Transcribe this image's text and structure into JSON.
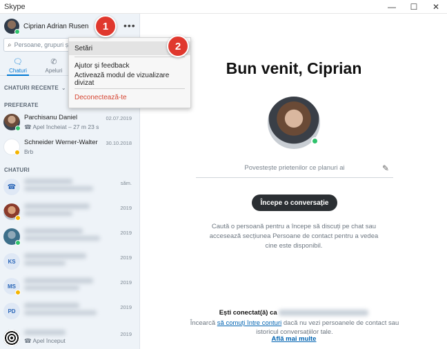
{
  "window": {
    "title": "Skype",
    "minimize": "—",
    "maximize": "☐",
    "close": "✕"
  },
  "profile": {
    "name": "Ciprian Adrian Rusen",
    "more": "•••"
  },
  "search": {
    "placeholder": "Persoane, grupuri și mesaje",
    "icon": "search-icon"
  },
  "nav": {
    "chats": "Chaturi",
    "calls": "Apeluri"
  },
  "sections": {
    "recent": "CHATURI RECENTE",
    "favorites": "PREFERATE",
    "chats": "CHATURI"
  },
  "menu": {
    "settings": "Setări",
    "help": "Ajutor și feedback",
    "split_view": "Activează modul de vizualizare divizat",
    "sign_out": "Deconectează-te"
  },
  "badges": {
    "one": "1",
    "two": "2"
  },
  "favorites": [
    {
      "name": "Parchisanu Daniel",
      "sub": "Apel încheiat – 27 m 23 s",
      "date": "02.07.2019",
      "presence": "online"
    },
    {
      "name": "Schneider Werner-Walter",
      "sub": "Brb",
      "date": "30.10.2018",
      "presence": "away"
    }
  ],
  "chats": [
    {
      "date": "săm.",
      "initials": "",
      "presence": ""
    },
    {
      "date": "2019",
      "initials": "",
      "presence": "away"
    },
    {
      "date": "2019",
      "initials": "",
      "presence": "online"
    },
    {
      "date": "2019",
      "initials": "KS",
      "presence": ""
    },
    {
      "date": "2019",
      "initials": "MS",
      "presence": "away"
    },
    {
      "date": "2019",
      "initials": "PD",
      "presence": ""
    },
    {
      "date": "2019",
      "initials": "",
      "presence": "",
      "sub": "Apel început"
    }
  ],
  "main": {
    "welcome": "Bun venit, Ciprian",
    "mood_placeholder": "Povestește prietenilor ce planuri ai",
    "start_button": "Începe o conversație",
    "hint": "Caută o persoană pentru a începe să discuți pe chat sau accesează secțiunea Persoane de contact pentru a vedea cine este disponibil.",
    "connected_prefix": "Ești conectat(ă) ca",
    "switch_prefix": "Încearcă",
    "switch_link": "să comuți între conturi",
    "switch_suffix": "dacă nu vezi persoanele de contact sau istoricul conversațiilor tale.",
    "learn_more": "Află mai multe"
  }
}
